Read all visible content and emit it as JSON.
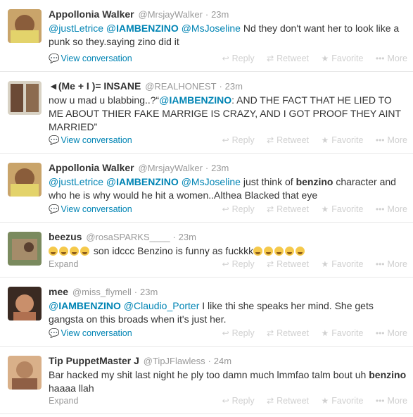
{
  "actions": {
    "reply": "Reply",
    "retweet": "Retweet",
    "favorite": "Favorite",
    "more": "More"
  },
  "tweets": [
    {
      "fullname": "Appollonia Walker",
      "username": "@MrsjayWalker",
      "time": "23m",
      "m1": "@justLetrice",
      "m2": "@",
      "m2b": "IAMBENZINO",
      "m3": "@MsJoseline",
      "text": "Nd they don't want her to look like a punk so they.saying zino did it",
      "footer": "View conversation"
    },
    {
      "fullname": "◄(Me + I )= INSANE",
      "username": "@REALHONEST",
      "time": "23m",
      "t1": "now u mad u blabbing..?“",
      "m1": "@",
      "m1b": "IAMBENZINO",
      "t2": ": AND THE FACT THAT HE LIED TO ME ABOUT THIER FAKE MARRIGE IS CRAZY, AND I GOT PROOF THEY AINT MARRIED”",
      "footer": "View conversation"
    },
    {
      "fullname": "Appollonia Walker",
      "username": "@MrsjayWalker",
      "time": "23m",
      "m1": "@justLetrice",
      "m2": "@",
      "m2b": "IAMBENZINO",
      "m3": "@MsJoseline",
      "t1": "just think of",
      "kw": "benzino",
      "t2": "character and who he is why would he hit a women..Althea Blacked that eye",
      "footer": "View conversation"
    },
    {
      "fullname": "beezus",
      "username": "@rosaSPARKS____",
      "time": "23m",
      "t1": "son idccc Benzino is funny as fuckkk",
      "footer": "Expand"
    },
    {
      "fullname": "mee",
      "username": "@miss_flymell",
      "time": "23m",
      "m1": "@",
      "m1b": "IAMBENZINO",
      "m2": "@Claudio_Porter",
      "t1": "I like thi she speaks her mind.  She gets gangsta on this broads when it's just her.",
      "footer": "View conversation"
    },
    {
      "fullname": "Tip PuppetMaster J",
      "username": "@TipJFlawless",
      "time": "24m",
      "t1": "Bar hacked my shit last night he ply too damn much lmmfao talm bout uh",
      "kw": "benzino",
      "t2": "haaaa llah",
      "footer": "Expand"
    }
  ]
}
